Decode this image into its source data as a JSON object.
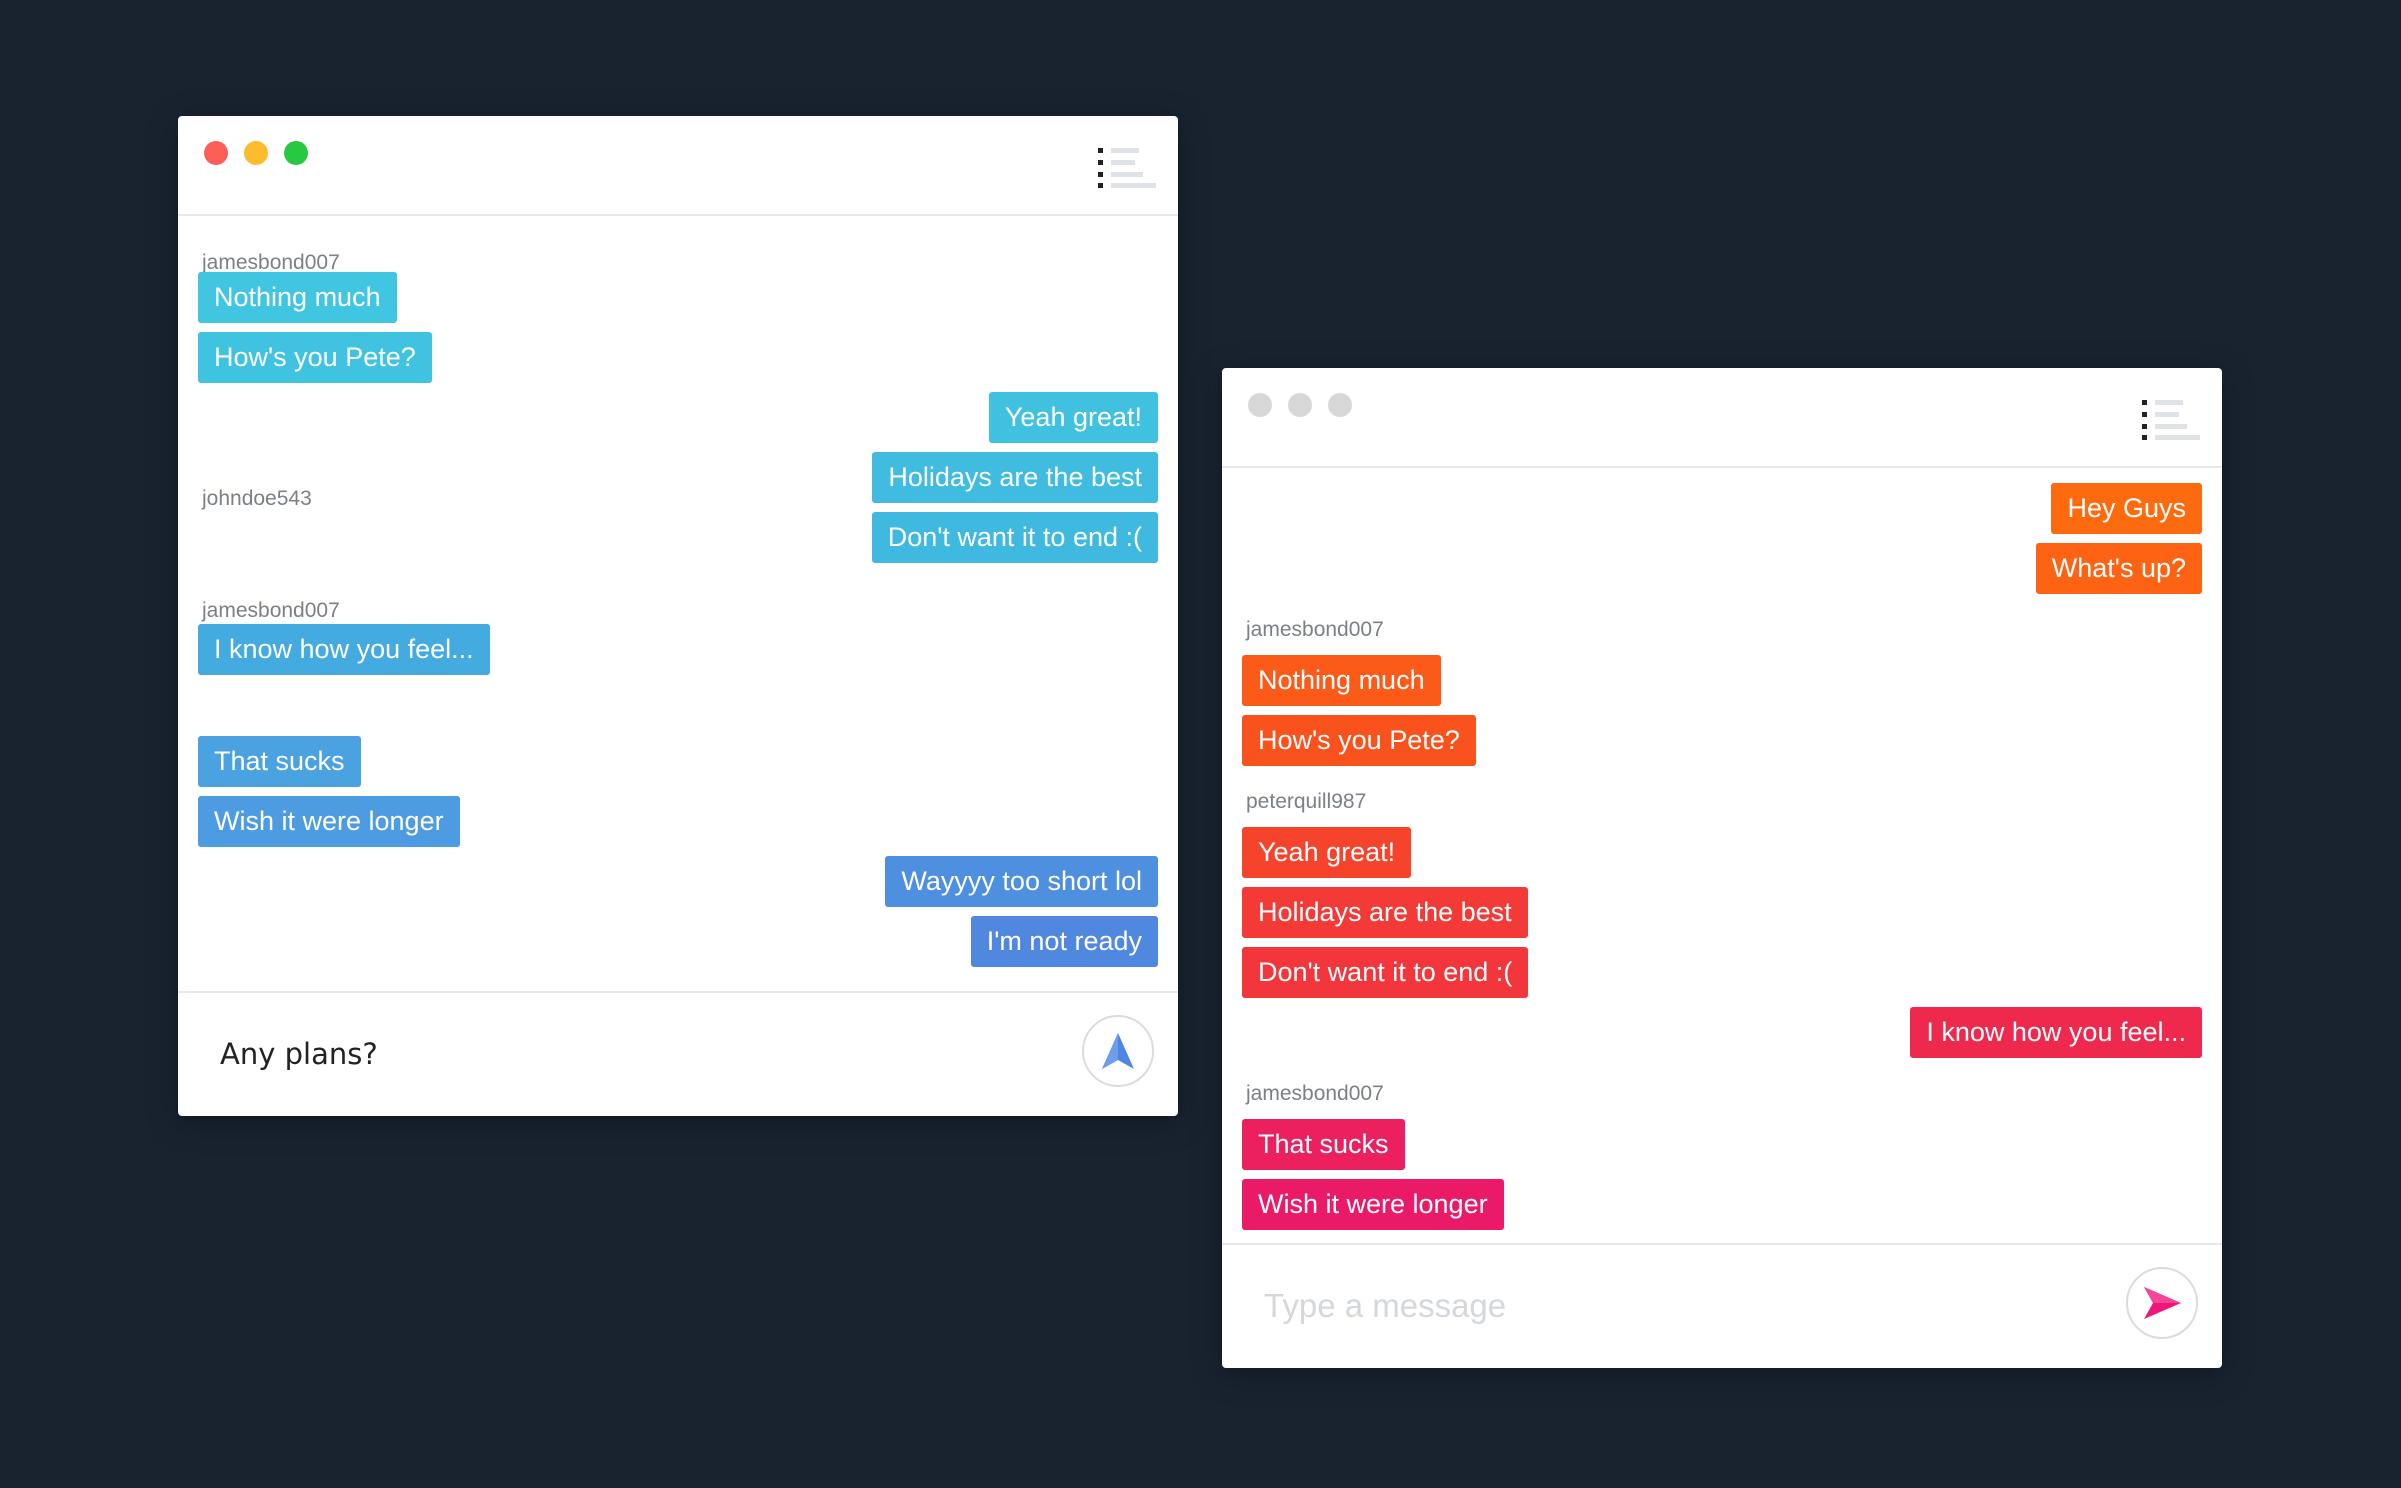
{
  "colors": {
    "background": "#192330",
    "traffic_red": "#fc5f57",
    "traffic_yellow": "#fdbc2e",
    "traffic_green": "#28c840",
    "traffic_inactive": "#d8d8d8",
    "left_send_icon": "#4e86e4",
    "right_send_icon": "#f0157a"
  },
  "left_window": {
    "groups": [
      {
        "username": "jamesbond007",
        "messages": [
          {
            "text": "Nothing much",
            "color": "#41c6e2"
          },
          {
            "text": "How's you Pete?",
            "color": "#40c3e1"
          }
        ]
      },
      {
        "username": "",
        "messages": [
          {
            "text": "Yeah great!",
            "color": "#3fc1df"
          },
          {
            "text": "Holidays are the best",
            "color": "#3fbcdf"
          },
          {
            "text": "Don't want it to end :(",
            "color": "#3fb9df"
          }
        ]
      },
      {
        "username": "johndoe543",
        "messages": [
          {
            "text": "I know how you feel...",
            "color": "#43abe0"
          }
        ]
      },
      {
        "username": "jamesbond007",
        "messages": [
          {
            "text": "That sucks",
            "color": "#4aa2e1"
          },
          {
            "text": "Wish it were longer",
            "color": "#4d9be1"
          }
        ]
      },
      {
        "username": "",
        "messages": [
          {
            "text": "Wayyyy too short lol",
            "color": "#4e8fe0"
          },
          {
            "text": "I'm not ready",
            "color": "#5088e0"
          }
        ]
      }
    ],
    "input": {
      "value": "Any plans?",
      "placeholder": "Type a message"
    },
    "menu_icon": "list-icon",
    "send_icon": "send-arrow-icon"
  },
  "right_window": {
    "groups": [
      {
        "username": "",
        "messages": [
          {
            "text": "Hey Guys",
            "color": "#fe6a0e"
          },
          {
            "text": "What's up?",
            "color": "#fd6312"
          }
        ]
      },
      {
        "username": "jamesbond007",
        "messages": [
          {
            "text": "Nothing much",
            "color": "#fb5a18"
          },
          {
            "text": "How's you Pete?",
            "color": "#f9521d"
          }
        ]
      },
      {
        "username": "peterquill987",
        "messages": [
          {
            "text": "Yeah great!",
            "color": "#f6432b"
          },
          {
            "text": "Holidays are the best",
            "color": "#f43a37"
          },
          {
            "text": "Don't want it to end :(",
            "color": "#f2363c"
          }
        ]
      },
      {
        "username": "",
        "messages": [
          {
            "text": "I know how you feel...",
            "color": "#ef294d"
          }
        ]
      },
      {
        "username": "jamesbond007",
        "messages": [
          {
            "text": "That sucks",
            "color": "#ec1f5f"
          },
          {
            "text": "Wish it were longer",
            "color": "#ea1a68"
          }
        ]
      }
    ],
    "input": {
      "value": "",
      "placeholder": "Type a message"
    },
    "menu_icon": "list-icon",
    "send_icon": "send-arrow-icon"
  }
}
